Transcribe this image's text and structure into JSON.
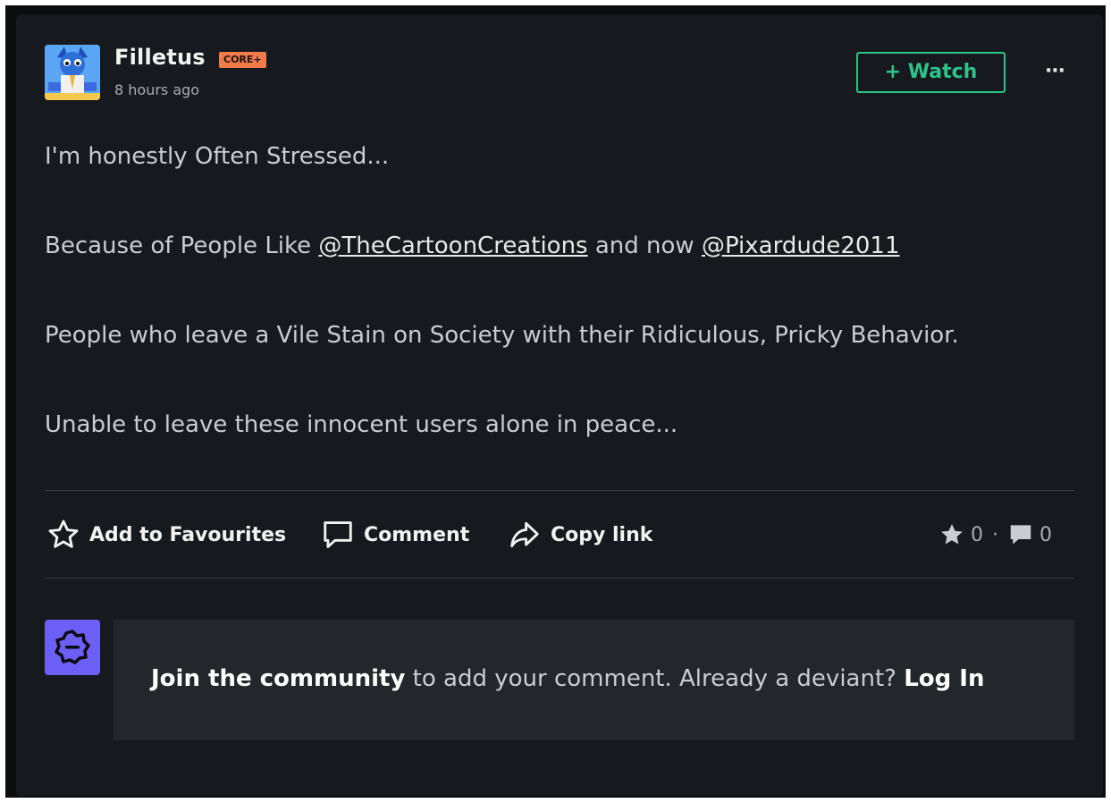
{
  "post": {
    "author": "Filletus",
    "badge": "CORE+",
    "timestamp": "8 hours ago",
    "watch_label": "+ Watch",
    "more_label": "···",
    "lines": {
      "line1": "I'm honestly Often Stressed...",
      "line2_prefix": "Because of People Like ",
      "mention1": "@TheCartoonCreations",
      "line2_middle": " and now ",
      "mention2": "@Pixardude2011",
      "line3": "People who leave a Vile Stain on Society with their Ridiculous, Pricky Behavior.",
      "line4": "Unable to leave these innocent users alone in peace..."
    }
  },
  "actions": {
    "favourite_label": "Add to Favourites",
    "comment_label": "Comment",
    "copy_label": "Copy link"
  },
  "stats": {
    "favourites": "0",
    "separator": "·",
    "comments": "0"
  },
  "join": {
    "join_label": "Join the community",
    "middle_text": " to add your comment. Already a deviant? ",
    "login_label": "Log In"
  },
  "icons": {
    "favourite": "star-outline-icon",
    "comment": "speech-bubble-icon",
    "copy": "share-arrow-icon",
    "stat_fav": "star-filled-icon",
    "stat_comment": "speech-bubble-filled-icon",
    "guest": "deviant-guest-icon"
  },
  "colors": {
    "accent_green": "#2ec38a",
    "core_badge": "#f27b4b",
    "guest_avatar": "#6c5ff5",
    "background": "#16191d"
  }
}
